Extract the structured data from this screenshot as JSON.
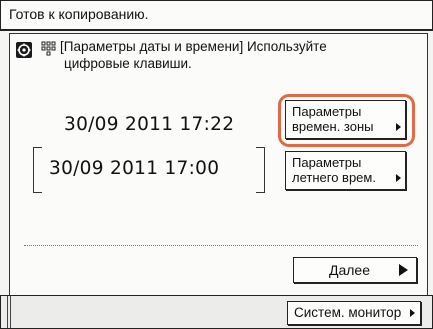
{
  "status": {
    "text": "Готов к копированию."
  },
  "instruction": {
    "line1": "[Параметры даты и времени] Используйте",
    "line2": "цифровые клавиши.",
    "icon": "settings-icon",
    "keypad_icon": "numeric-keypad-icon"
  },
  "datetime": {
    "current": "30/09 2011 17:22",
    "summer": "30/09 2011 17:00"
  },
  "buttons": {
    "timezone": {
      "line1": "Параметры",
      "line2": "времен. зоны"
    },
    "dst": {
      "line1": "Параметры",
      "line2": "летнего врем."
    },
    "next": "Далее",
    "monitor": "Систем. монитор"
  },
  "colors": {
    "highlight": "#e06a45"
  }
}
